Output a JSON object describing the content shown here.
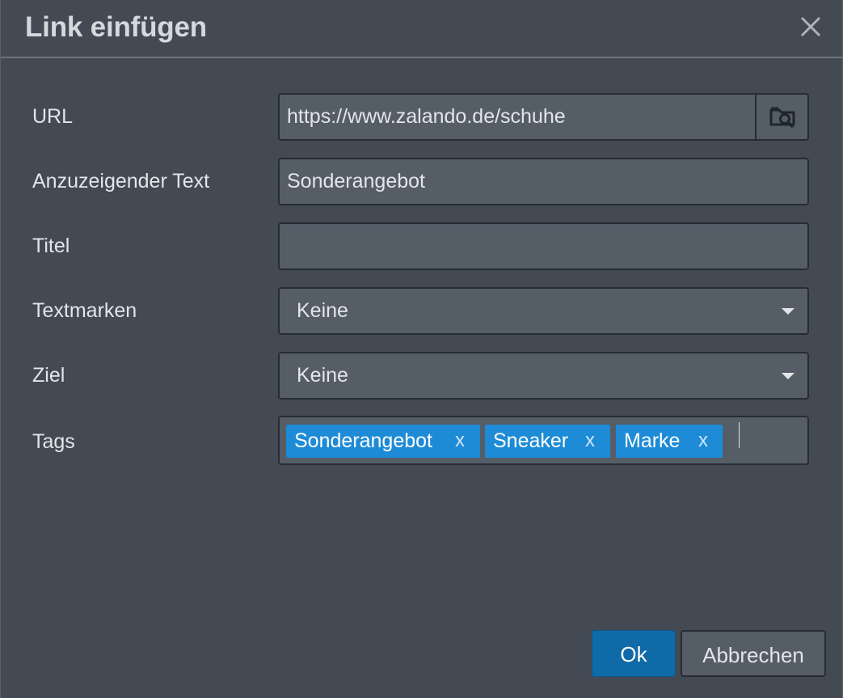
{
  "dialog": {
    "title": "Link einfügen",
    "close_icon": "close-icon"
  },
  "form": {
    "url": {
      "label": "URL",
      "value": "https://www.zalando.de/schuhe",
      "browse_icon": "folder-search-icon"
    },
    "text": {
      "label": "Anzuzeigender Text",
      "value": "Sonderangebot"
    },
    "title": {
      "label": "Titel",
      "value": ""
    },
    "anchors": {
      "label": "Textmarken",
      "selected": "Keine"
    },
    "target": {
      "label": "Ziel",
      "selected": "Keine"
    },
    "tags": {
      "label": "Tags",
      "items": [
        {
          "label": "Sonderangebot",
          "remove": "x"
        },
        {
          "label": "Sneaker",
          "remove": "x"
        },
        {
          "label": "Marke",
          "remove": "x"
        }
      ]
    }
  },
  "footer": {
    "ok_label": "Ok",
    "cancel_label": "Abbrechen"
  },
  "colors": {
    "background": "#434a54",
    "field": "#555d67",
    "tag": "#1e8bd6",
    "primary_button": "#0f6aa7"
  }
}
